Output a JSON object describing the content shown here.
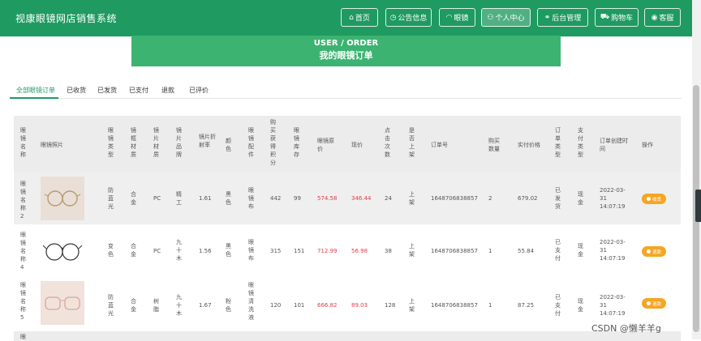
{
  "header": {
    "brand": "视康眼镜网店销售系统",
    "nav": [
      {
        "label": "首页",
        "icon": "home-icon",
        "glyph": "⌂"
      },
      {
        "label": "公告信息",
        "icon": "clock-icon",
        "glyph": "◷"
      },
      {
        "label": "眼镜",
        "icon": "glasses-icon",
        "glyph": "◠"
      },
      {
        "label": "个人中心",
        "icon": "user-icon",
        "glyph": "⚇"
      },
      {
        "label": "后台管理",
        "icon": "link-icon",
        "glyph": "⚭"
      },
      {
        "label": "购物车",
        "icon": "cart-icon",
        "glyph": "⛟"
      },
      {
        "label": "客服",
        "icon": "chat-icon",
        "glyph": "◉"
      }
    ],
    "active_nav": "个人中心"
  },
  "banner": {
    "line1": "USER / ORDER",
    "line2": "我的眼镜订单"
  },
  "tabs": [
    "全部眼镜订单",
    "已收货",
    "已发货",
    "已支付",
    "退款",
    "已评价"
  ],
  "active_tab": "全部眼镜订单",
  "table": {
    "headers": [
      "眼镜名称",
      "眼镜照片",
      "眼镜类型",
      "镜框材质",
      "镜片材质",
      "镜片品牌",
      "镜片折射率",
      "颜色",
      "眼镜配件",
      "购买获得积分",
      "眼镜库存",
      "眼镜原价",
      "现价",
      "点击次数",
      "是否上架",
      "订单号",
      "购买数量",
      "实付价格",
      "订单类型",
      "支付类型",
      "订单创建时间",
      "操作"
    ],
    "rows": [
      {
        "name": "眼镜名称2",
        "type": "防蓝光",
        "frame": "合金",
        "lens": "PC",
        "brand": "精工",
        "index": "1.61",
        "color": "黑色",
        "accessory": "眼镜布",
        "points": "442",
        "stock": "99",
        "orig": "574.58",
        "price": "346.44",
        "clicks": "24",
        "listed": "上架",
        "order_no": "1648706838857",
        "qty": "2",
        "paid": "679.02",
        "status": "已发货",
        "pay": "现金",
        "date": "2022-03-31",
        "time": "14:07:19",
        "action": "收货"
      },
      {
        "name": "眼镜名称4",
        "type": "变色",
        "frame": "合金",
        "lens": "PC",
        "brand": "九十木",
        "index": "1.56",
        "color": "黑色",
        "accessory": "眼镜布",
        "points": "315",
        "stock": "151",
        "orig": "712.99",
        "price": "56.98",
        "clicks": "38",
        "listed": "上架",
        "order_no": "1648706838857",
        "qty": "1",
        "paid": "55.84",
        "status": "已支付",
        "pay": "现金",
        "date": "2022-03-31",
        "time": "14:07:19",
        "action": "退款"
      },
      {
        "name": "眼镜名称5",
        "type": "防蓝光",
        "frame": "合金",
        "lens": "树脂",
        "brand": "九十木",
        "index": "1.67",
        "color": "粉色",
        "accessory": "眼镜清洗液",
        "points": "120",
        "stock": "101",
        "orig": "666.82",
        "price": "89.03",
        "clicks": "128",
        "listed": "上架",
        "order_no": "1648706838857",
        "qty": "1",
        "paid": "87.25",
        "status": "已支付",
        "pay": "现金",
        "date": "2022-03-31",
        "time": "14:07:19",
        "action": "退款"
      }
    ],
    "partial_row": {
      "name": "眼"
    }
  },
  "watermark": "CSDN @懒羊羊g",
  "colors": {
    "brand_green": "#1f9a61",
    "banner_green": "#3cb371",
    "price_red": "#e0404a",
    "action_orange": "#f5a623"
  }
}
